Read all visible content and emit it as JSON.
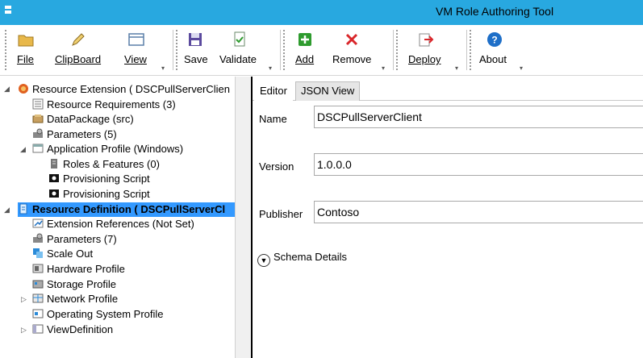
{
  "window": {
    "title": "VM Role Authoring Tool"
  },
  "toolbar": {
    "file": "File",
    "clipboard": "ClipBoard",
    "view": "View",
    "save": "Save",
    "validate": "Validate",
    "add": "Add",
    "remove": "Remove",
    "deploy": "Deploy",
    "about": "About"
  },
  "tree": {
    "resource_extension": "Resource Extension ( DSCPullServerClien",
    "resource_requirements": "Resource Requirements (3)",
    "data_package": "DataPackage (src)",
    "parameters_ext": "Parameters (5)",
    "application_profile": "Application Profile (Windows)",
    "roles_features": "Roles & Features (0)",
    "provisioning_script_1": "Provisioning Script",
    "provisioning_script_2": "Provisioning Script",
    "resource_definition": "Resource Definition ( DSCPullServerCl",
    "extension_references": "Extension References (Not Set)",
    "parameters_def": "Parameters (7)",
    "scale_out": "Scale Out",
    "hardware_profile": "Hardware Profile",
    "storage_profile": "Storage Profile",
    "network_profile": "Network Profile",
    "os_profile": "Operating System Profile",
    "view_definition": "ViewDefinition"
  },
  "editor": {
    "tabs": [
      "Editor",
      "JSON View"
    ],
    "name_label": "Name",
    "name_value": "DSCPullServerClient",
    "version_label": "Version",
    "version_value": "1.0.0.0",
    "publisher_label": "Publisher",
    "publisher_value": "Contoso",
    "schema_details": "Schema Details"
  },
  "colors": {
    "titlebar": "#28a8e0",
    "selection": "#3399ff",
    "add_icon": "#2e9b2e",
    "remove_icon": "#d9262a",
    "about_icon": "#1e6fc8"
  }
}
